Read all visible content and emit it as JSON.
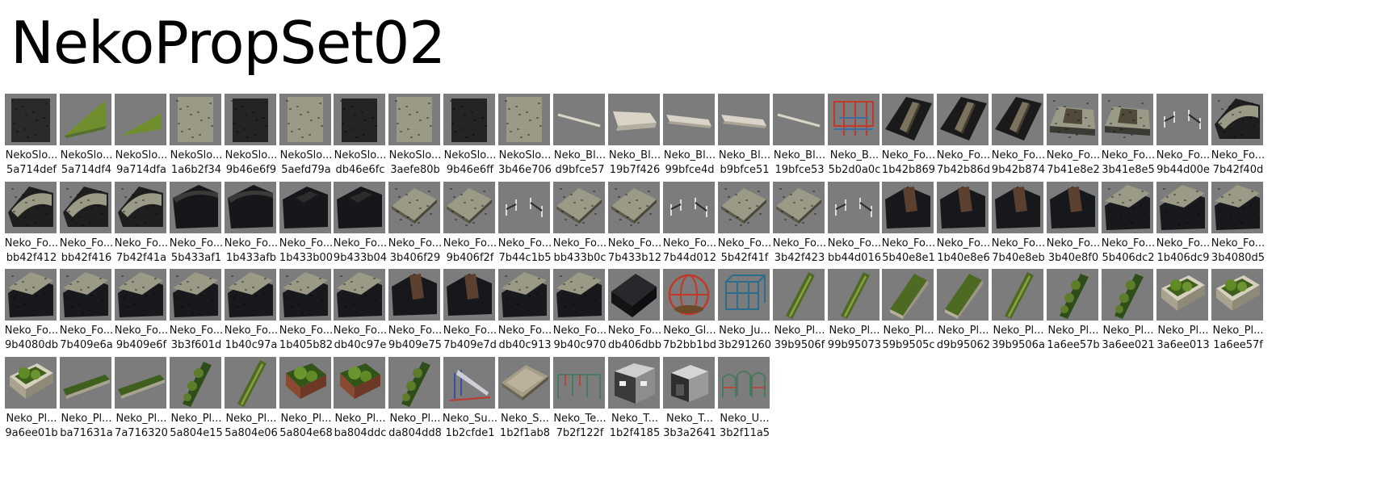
{
  "title": "NekoPropSet02",
  "items": [
    {
      "name": "NekoSlo...",
      "id": "5a714def",
      "icon": "dark-stone-slab"
    },
    {
      "name": "NekoSlo...",
      "id": "5a714df4",
      "icon": "grass-triangle"
    },
    {
      "name": "NekoSlo...",
      "id": "9a714dfa",
      "icon": "grass-triangle-small"
    },
    {
      "name": "NekoSlo...",
      "id": "1a6b2f34",
      "icon": "stone-slab"
    },
    {
      "name": "NekoSlo...",
      "id": "9b46e6f9",
      "icon": "dark-slab"
    },
    {
      "name": "NekoSlo...",
      "id": "5aefd79a",
      "icon": "stone-slab"
    },
    {
      "name": "NekoSlo...",
      "id": "db46e6fc",
      "icon": "dark-slab"
    },
    {
      "name": "NekoSlo...",
      "id": "3aefe80b",
      "icon": "stone-slab"
    },
    {
      "name": "NekoSlo...",
      "id": "9b46e6ff",
      "icon": "dark-slab"
    },
    {
      "name": "NekoSlo...",
      "id": "3b46e706",
      "icon": "stone-slab"
    },
    {
      "name": "Neko_Bl...",
      "id": "d9bfce57",
      "icon": "thin-beam"
    },
    {
      "name": "Neko_Bl...",
      "id": "19b7f426",
      "icon": "wide-beam"
    },
    {
      "name": "Neko_Bl...",
      "id": "99bfce4d",
      "icon": "medium-beam"
    },
    {
      "name": "Neko_Bl...",
      "id": "b9bfce51",
      "icon": "medium-beam"
    },
    {
      "name": "Neko_Bl...",
      "id": "19bfce53",
      "icon": "thin-beam"
    },
    {
      "name": "Neko_B...",
      "id": "5b2d0a0c",
      "icon": "scaffold-frame"
    },
    {
      "name": "Neko_Fo...",
      "id": "1b42b869",
      "icon": "foundation-rail"
    },
    {
      "name": "Neko_Fo...",
      "id": "7b42b86d",
      "icon": "foundation-rail"
    },
    {
      "name": "Neko_Fo...",
      "id": "9b42b874",
      "icon": "foundation-rail"
    },
    {
      "name": "Neko_Fo...",
      "id": "7b41e8e2",
      "icon": "foundation-u"
    },
    {
      "name": "Neko_Fo...",
      "id": "3b41e8e5",
      "icon": "foundation-u"
    },
    {
      "name": "Neko_Fo...",
      "id": "9b44d00e",
      "icon": "fence-posts"
    },
    {
      "name": "Neko_Fo...",
      "id": "7b42f40d",
      "icon": "foundation-curve"
    },
    {
      "name": "Neko_Fo...",
      "id": "bb42f412",
      "icon": "foundation-curve"
    },
    {
      "name": "Neko_Fo...",
      "id": "bb42f416",
      "icon": "foundation-curve"
    },
    {
      "name": "Neko_Fo...",
      "id": "7b42f41a",
      "icon": "foundation-curve"
    },
    {
      "name": "Neko_Fo...",
      "id": "5b433af1",
      "icon": "dark-block-curve"
    },
    {
      "name": "Neko_Fo...",
      "id": "1b433afb",
      "icon": "dark-block-curve"
    },
    {
      "name": "Neko_Fo...",
      "id": "1b433b00",
      "icon": "dark-block-notch"
    },
    {
      "name": "Neko_Fo...",
      "id": "9b433b04",
      "icon": "dark-block-notch"
    },
    {
      "name": "Neko_Fo...",
      "id": "3b406f29",
      "icon": "flat-ground"
    },
    {
      "name": "Neko_Fo...",
      "id": "9b406f2f",
      "icon": "flat-ground"
    },
    {
      "name": "Neko_Fo...",
      "id": "7b44c1b5",
      "icon": "fence-posts"
    },
    {
      "name": "Neko_Fo...",
      "id": "bb433b0c",
      "icon": "flat-ground"
    },
    {
      "name": "Neko_Fo...",
      "id": "7b433b12",
      "icon": "flat-ground"
    },
    {
      "name": "Neko_Fo...",
      "id": "7b44d012",
      "icon": "fence-posts"
    },
    {
      "name": "Neko_Fo...",
      "id": "5b42f41f",
      "icon": "flat-ground"
    },
    {
      "name": "Neko_Fo...",
      "id": "3b42f423",
      "icon": "flat-ground"
    },
    {
      "name": "Neko_Fo...",
      "id": "bb44d016",
      "icon": "fence-posts"
    },
    {
      "name": "Neko_Fo...",
      "id": "5b40e8e1",
      "icon": "dark-block-plank"
    },
    {
      "name": "Neko_Fo...",
      "id": "1b40e8e6",
      "icon": "dark-block-plank"
    },
    {
      "name": "Neko_Fo...",
      "id": "7b40e8eb",
      "icon": "dark-block-plank"
    },
    {
      "name": "Neko_Fo...",
      "id": "3b40e8f0",
      "icon": "dark-block-plank"
    },
    {
      "name": "Neko_Fo...",
      "id": "5b406dc2",
      "icon": "dark-block-top"
    },
    {
      "name": "Neko_Fo...",
      "id": "1b406dc9",
      "icon": "dark-block-top"
    },
    {
      "name": "Neko_Fo...",
      "id": "3b4080d5",
      "icon": "dark-block-top"
    },
    {
      "name": "Neko_Fo...",
      "id": "9b4080db",
      "icon": "dark-block-top"
    },
    {
      "name": "Neko_Fo...",
      "id": "7b409e6a",
      "icon": "dark-block-top"
    },
    {
      "name": "Neko_Fo...",
      "id": "9b409e6f",
      "icon": "dark-block-top"
    },
    {
      "name": "Neko_Fo...",
      "id": "3b3f601d",
      "icon": "dark-block-top"
    },
    {
      "name": "Neko_Fo...",
      "id": "1b40c97a",
      "icon": "dark-block-top"
    },
    {
      "name": "Neko_Fo...",
      "id": "1b405b82",
      "icon": "dark-block-top"
    },
    {
      "name": "Neko_Fo...",
      "id": "db40c97e",
      "icon": "dark-block-top"
    },
    {
      "name": "Neko_Fo...",
      "id": "9b409e75",
      "icon": "dark-block-plank"
    },
    {
      "name": "Neko_Fo...",
      "id": "7b409e7d",
      "icon": "dark-block-plank"
    },
    {
      "name": "Neko_Fo...",
      "id": "db40c913",
      "icon": "dark-block-top"
    },
    {
      "name": "Neko_Fo...",
      "id": "9b40c970",
      "icon": "dark-block-top"
    },
    {
      "name": "Neko_Fo...",
      "id": "db406dbb",
      "icon": "dark-block-plain"
    },
    {
      "name": "Neko_Gl...",
      "id": "7b2bb1bd",
      "icon": "globe-sphere"
    },
    {
      "name": "Neko_Ju...",
      "id": "3b291260",
      "icon": "jungle-gym"
    },
    {
      "name": "Neko_Pl...",
      "id": "39b9506f",
      "icon": "planter-long"
    },
    {
      "name": "Neko_Pl...",
      "id": "99b95073",
      "icon": "planter-long"
    },
    {
      "name": "Neko_Pl...",
      "id": "59b9505c",
      "icon": "planter-hedge"
    },
    {
      "name": "Neko_Pl...",
      "id": "d9b95062",
      "icon": "planter-hedge"
    },
    {
      "name": "Neko_Pl...",
      "id": "39b9506a",
      "icon": "planter-long"
    },
    {
      "name": "Neko_Pl...",
      "id": "1a6ee57b",
      "icon": "planter-shrub"
    },
    {
      "name": "Neko_Pl...",
      "id": "3a6ee021",
      "icon": "planter-shrub"
    },
    {
      "name": "Neko_Pl...",
      "id": "3a6ee013",
      "icon": "planter-box"
    },
    {
      "name": "Neko_Pl...",
      "id": "1a6ee57f",
      "icon": "planter-box"
    },
    {
      "name": "Neko_Pl...",
      "id": "9a6ee01b",
      "icon": "planter-box"
    },
    {
      "name": "Neko_Pl...",
      "id": "ba71631a",
      "icon": "planter-flat"
    },
    {
      "name": "Neko_Pl...",
      "id": "7a716320",
      "icon": "planter-flat"
    },
    {
      "name": "Neko_Pl...",
      "id": "5a804e15",
      "icon": "planter-shrub"
    },
    {
      "name": "Neko_Pl...",
      "id": "5a804e06",
      "icon": "planter-long"
    },
    {
      "name": "Neko_Pl...",
      "id": "5a804e68",
      "icon": "planter-brick"
    },
    {
      "name": "Neko_Pl...",
      "id": "ba804ddc",
      "icon": "planter-brick"
    },
    {
      "name": "Neko_Pl...",
      "id": "da804dd8",
      "icon": "planter-shrub"
    },
    {
      "name": "Neko_Su...",
      "id": "1b2cfde1",
      "icon": "slide"
    },
    {
      "name": "Neko_S...",
      "id": "1b2f1ab8",
      "icon": "sandbox"
    },
    {
      "name": "Neko_Te...",
      "id": "7b2f122f",
      "icon": "tetherball-frame"
    },
    {
      "name": "Neko_T...",
      "id": "1b2f4185",
      "icon": "toilet-building"
    },
    {
      "name": "Neko_T...",
      "id": "3b3a2641",
      "icon": "toilet-building-small"
    },
    {
      "name": "Neko_U...",
      "id": "3b2f11a5",
      "icon": "u-bars"
    }
  ],
  "colors": {
    "tile_bg": "#7c7c7c",
    "stone": "#9a9a86",
    "dark": "#1c1e22",
    "grass": "#6f8f2f",
    "hedge": "#4d6a22",
    "beam": "#d9d4c6",
    "brick": "#8a4a32"
  }
}
